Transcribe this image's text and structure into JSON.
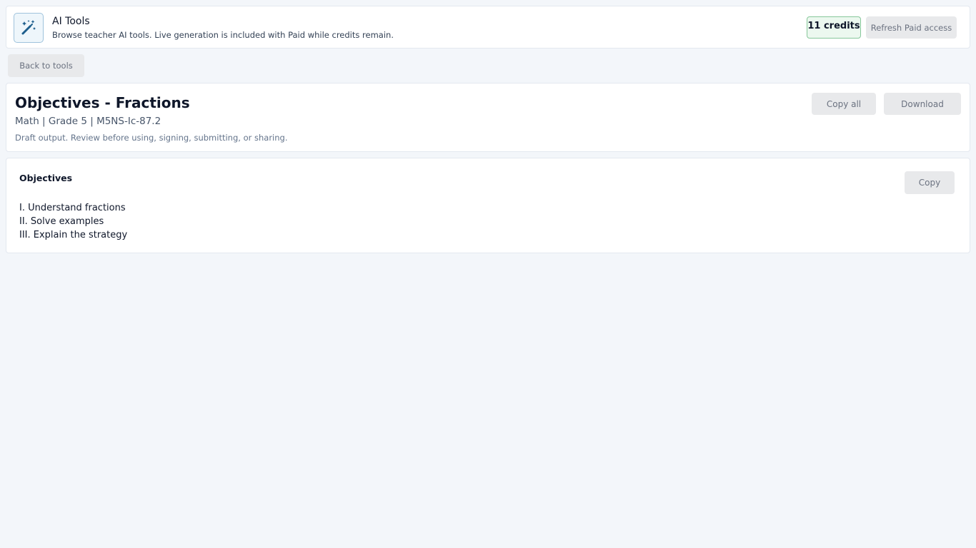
{
  "header": {
    "icon": "magic-wand-icon",
    "title": "AI Tools",
    "subtitle": "Browse teacher AI tools. Live generation is included with Paid while credits remain.",
    "credits": "11 credits",
    "refresh_label": "Refresh Paid access"
  },
  "nav": {
    "back_label": "Back to tools"
  },
  "document": {
    "title": "Objectives - Fractions",
    "meta": "Math | Grade 5 | M5NS-Ic-87.2",
    "note": "Draft output. Review before using, signing, submitting, or sharing.",
    "copy_all_label": "Copy all",
    "download_label": "Download"
  },
  "objectives": {
    "heading": "Objectives",
    "copy_label": "Copy",
    "items": [
      "I. Understand fractions",
      "II. Solve examples",
      "III. Explain the strategy"
    ]
  },
  "colors": {
    "background": "#f3f6fa",
    "card": "#ffffff",
    "icon_accent": "#1d5e8c",
    "credits_border": "#86c79a",
    "credits_bg": "#ecf8ef",
    "button_bg": "#e8e9eb"
  }
}
